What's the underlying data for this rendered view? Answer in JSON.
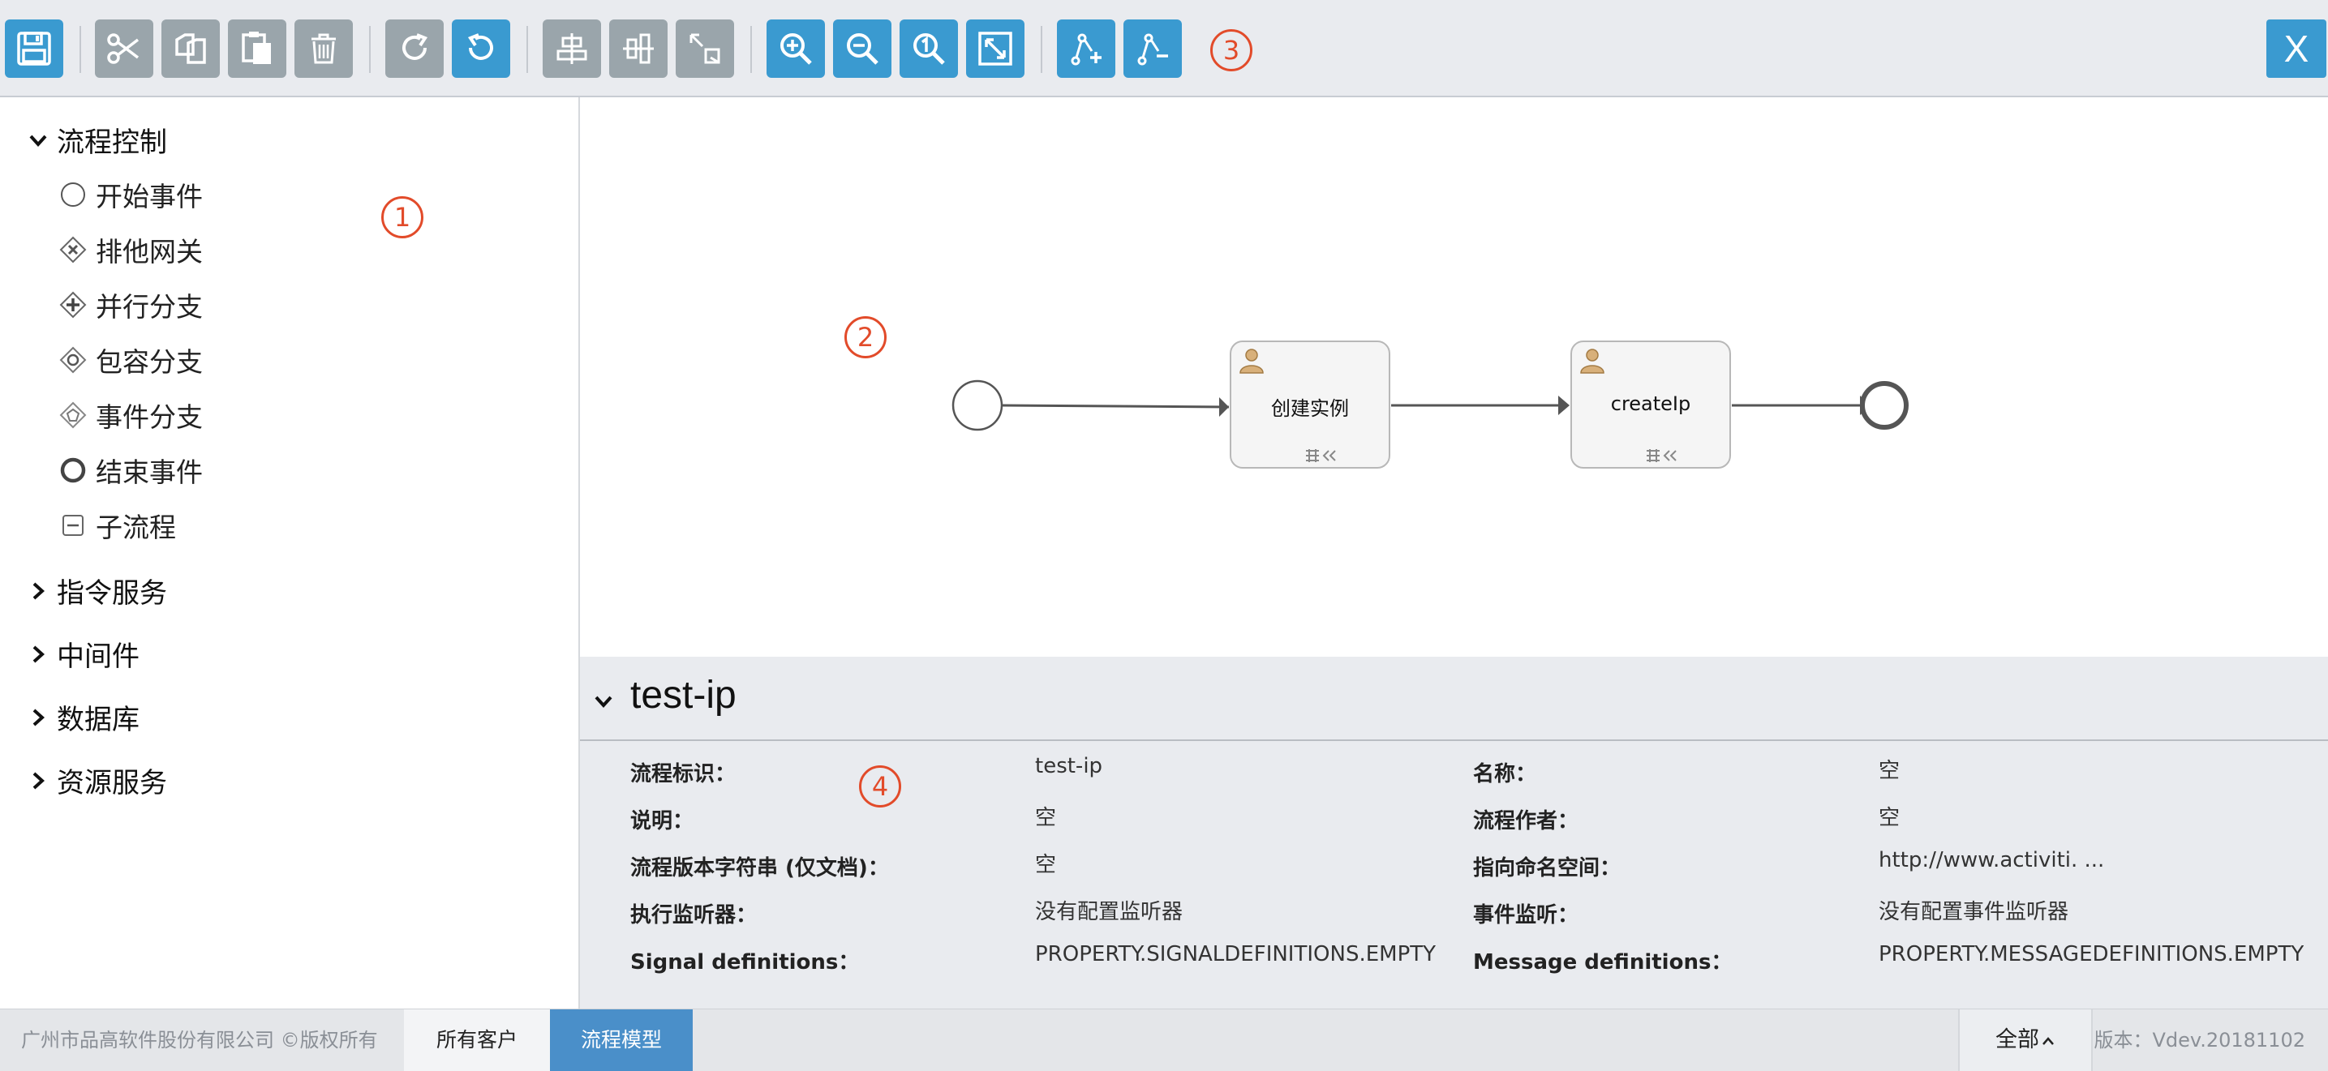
{
  "toolbar": {
    "buttons": [
      {
        "name": "save",
        "icon": "save-icon"
      },
      {
        "name": "cut",
        "icon": "scissors-icon"
      },
      {
        "name": "copy",
        "icon": "copy-icon"
      },
      {
        "name": "paste",
        "icon": "paste-icon"
      },
      {
        "name": "delete",
        "icon": "trash-icon"
      },
      {
        "name": "redo",
        "icon": "redo-icon"
      },
      {
        "name": "undo",
        "icon": "undo-icon"
      },
      {
        "name": "align-horizontal",
        "icon": "align-horizontal-icon"
      },
      {
        "name": "align-vertical",
        "icon": "align-vertical-icon"
      },
      {
        "name": "same-size",
        "icon": "same-size-icon"
      },
      {
        "name": "zoom-in",
        "icon": "zoom-in-icon"
      },
      {
        "name": "zoom-out",
        "icon": "zoom-out-icon"
      },
      {
        "name": "zoom-actual",
        "icon": "zoom-actual-icon"
      },
      {
        "name": "zoom-fit",
        "icon": "fit-screen-icon"
      },
      {
        "name": "add-bendpoint",
        "icon": "add-bendpoint-icon"
      },
      {
        "name": "remove-bendpoint",
        "icon": "remove-bendpoint-icon"
      }
    ],
    "close_label": "X"
  },
  "callouts": {
    "c1": "1",
    "c2": "2",
    "c3": "3",
    "c4": "4"
  },
  "palette": {
    "groups": [
      {
        "label": "流程控制",
        "expanded": true
      },
      {
        "label": "指令服务",
        "expanded": false
      },
      {
        "label": "中间件",
        "expanded": false
      },
      {
        "label": "数据库",
        "expanded": false
      },
      {
        "label": "资源服务",
        "expanded": false
      }
    ],
    "items": [
      {
        "label": "开始事件",
        "icon": "start-event-icon"
      },
      {
        "label": "排他网关",
        "icon": "exclusive-gateway-icon"
      },
      {
        "label": "并行分支",
        "icon": "parallel-gateway-icon"
      },
      {
        "label": "包容分支",
        "icon": "inclusive-gateway-icon"
      },
      {
        "label": "事件分支",
        "icon": "event-gateway-icon"
      },
      {
        "label": "结束事件",
        "icon": "end-event-icon"
      },
      {
        "label": "子流程",
        "icon": "subprocess-icon"
      }
    ]
  },
  "diagram": {
    "tasks": [
      {
        "label": "创建实例",
        "icon": "user-task-icon"
      },
      {
        "label": "createIp",
        "icon": "user-task-icon"
      }
    ]
  },
  "properties": {
    "title": "test-ip",
    "rows": [
      {
        "label": "流程标识：",
        "value": "test-ip",
        "label2": "名称：",
        "value2": "空"
      },
      {
        "label": "说明：",
        "value": "空",
        "label2": "流程作者：",
        "value2": "空"
      },
      {
        "label": "流程版本字符串 (仅文档)：",
        "value": "空",
        "label2": "指向命名空间：",
        "value2": "http://www.activiti. ..."
      },
      {
        "label": "执行监听器：",
        "value": "没有配置监听器",
        "label2": "事件监听：",
        "value2": "没有配置事件监听器"
      },
      {
        "label": "Signal definitions：",
        "value": "PROPERTY.SIGNALDEFINITIONS.EMPTY",
        "label2": "Message definitions：",
        "value2": "PROPERTY.MESSAGEDEFINITIONS.EMPTY"
      }
    ]
  },
  "footer": {
    "copyright": "广州市品高软件股份有限公司 ©版权所有",
    "tabs": [
      "所有客户",
      "流程模型"
    ],
    "scope": "全部",
    "version": "版本：Vdev.20181102"
  },
  "colors": {
    "toolbar_blue": "#3a9ad0",
    "toolbar_gray": "#9aa5ab",
    "callout": "#e24b2a",
    "tab_active": "#4a8fc9"
  }
}
